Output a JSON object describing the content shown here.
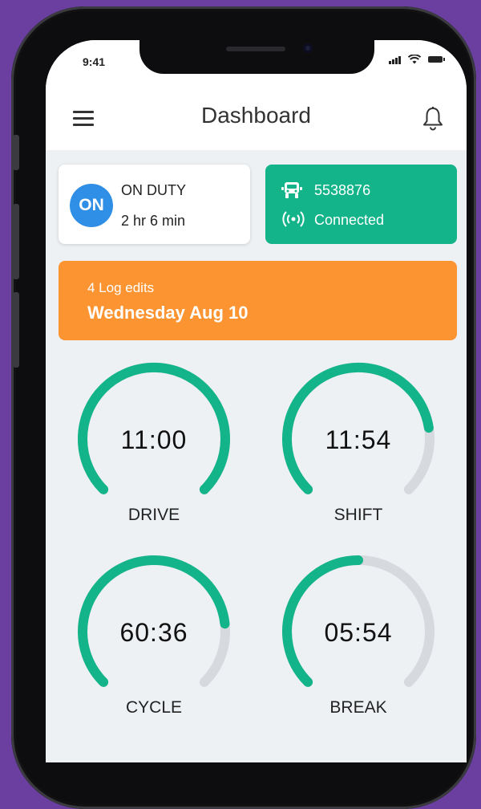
{
  "status_bar": {
    "time": "9:41"
  },
  "header": {
    "title": "Dashboard"
  },
  "duty": {
    "badge": "ON",
    "status": "ON DUTY",
    "elapsed": "2 hr 6 min"
  },
  "vehicle": {
    "id": "5538876",
    "connection": "Connected"
  },
  "banner": {
    "subtitle": "4 Log edits",
    "date": "Wednesday Aug 10"
  },
  "gauges": [
    {
      "value": "11:00",
      "label": "DRIVE",
      "fill": 1.0
    },
    {
      "value": "11:54",
      "label": "SHIFT",
      "fill": 0.8
    },
    {
      "value": "60:36",
      "label": "CYCLE",
      "fill": 0.81
    },
    {
      "value": "05:54",
      "label": "BREAK",
      "fill": 0.5
    }
  ],
  "colors": {
    "accent_green": "#13b489",
    "accent_orange": "#fd9432",
    "accent_blue": "#2f8ee6",
    "gauge_track": "#d6d9de",
    "background": "#eef1f4"
  }
}
